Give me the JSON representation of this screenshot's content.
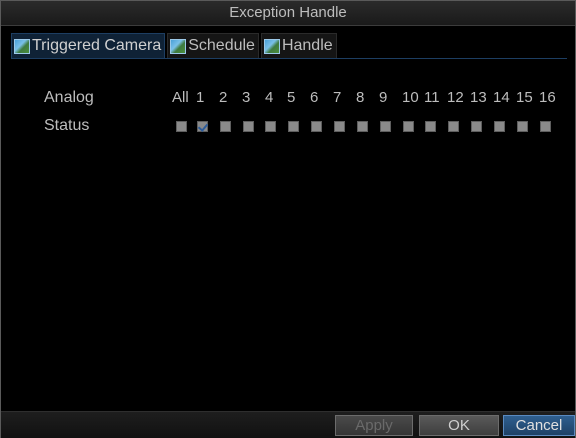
{
  "window": {
    "title": "Exception Handle"
  },
  "tabs": [
    {
      "label": "Triggered Camera",
      "active": true,
      "icon": "camera-icon"
    },
    {
      "label": "Schedule",
      "active": false,
      "icon": "camera-icon"
    },
    {
      "label": "Handle",
      "active": false,
      "icon": "camera-icon"
    }
  ],
  "analog": {
    "label": "Analog",
    "all_label": "All",
    "channels": [
      "1",
      "2",
      "3",
      "4",
      "5",
      "6",
      "7",
      "8",
      "9",
      "10",
      "11",
      "12",
      "13",
      "14",
      "15",
      "16"
    ]
  },
  "status": {
    "label": "Status",
    "checked": [
      false,
      true,
      false,
      false,
      false,
      false,
      false,
      false,
      false,
      false,
      false,
      false,
      false,
      false,
      false,
      false,
      false
    ]
  },
  "buttons": {
    "apply": "Apply",
    "ok": "OK",
    "cancel": "Cancel"
  },
  "colors": {
    "accent": "#2f5f8f",
    "text": "#bdbdbd",
    "checkmark": "#2d5c9a"
  }
}
